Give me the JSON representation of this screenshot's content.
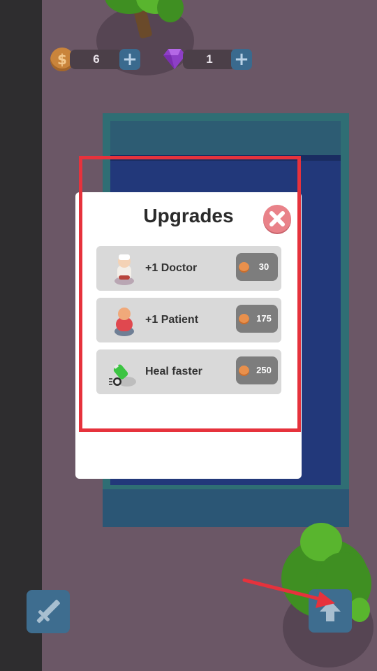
{
  "hud": {
    "coins_value": "6",
    "gems_value": "1",
    "coins_plus": "+",
    "gems_plus": "+",
    "coin_symbol": "$"
  },
  "dialog": {
    "title": "Upgrades",
    "items": [
      {
        "label": "+1 Doctor",
        "price": "30",
        "icon": "doctor-icon"
      },
      {
        "label": "+1 Patient",
        "price": "175",
        "icon": "patient-icon"
      },
      {
        "label": "Heal faster",
        "price": "250",
        "icon": "heal-faster-icon"
      }
    ]
  },
  "colors": {
    "background": "#6b5766",
    "highlight": "#e6323c",
    "button_blue": "#3e6d8f",
    "close_button": "#e98289"
  }
}
